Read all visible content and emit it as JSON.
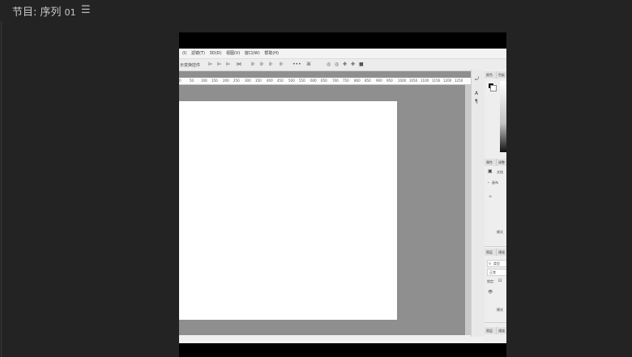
{
  "header": {
    "title_prefix": "节目: 序列",
    "title_seq": "01",
    "menu_icon": "☰"
  },
  "ps": {
    "menu_items": [
      "(I)",
      "滤镜(T)",
      "3D(D)",
      "视图(V)",
      "窗口(W)",
      "帮助(H)"
    ],
    "options_label": "示变换控件",
    "ruler_ticks": [
      "0",
      "50",
      "100",
      "150",
      "200",
      "250",
      "300",
      "350",
      "400",
      "450",
      "500",
      "550",
      "600",
      "650",
      "700",
      "750",
      "800",
      "850",
      "900",
      "950",
      "1000",
      "1050",
      "1100",
      "1150",
      "1200",
      "1250"
    ],
    "panels": {
      "color_tab": "颜色",
      "swatches_tab": "色板",
      "props_tab": "属性",
      "adjust_tab": "调整",
      "doc_label": "文档",
      "canvas_label": "画布",
      "mode_label": "模式",
      "layers_tab": "图层",
      "channels_tab": "通道",
      "search_placeholder": "类型",
      "normal_label": "正常",
      "lock_label": "锁定:",
      "mode_label2": "模式",
      "layers_tab2": "图层",
      "channels_tab2": "通道"
    }
  }
}
